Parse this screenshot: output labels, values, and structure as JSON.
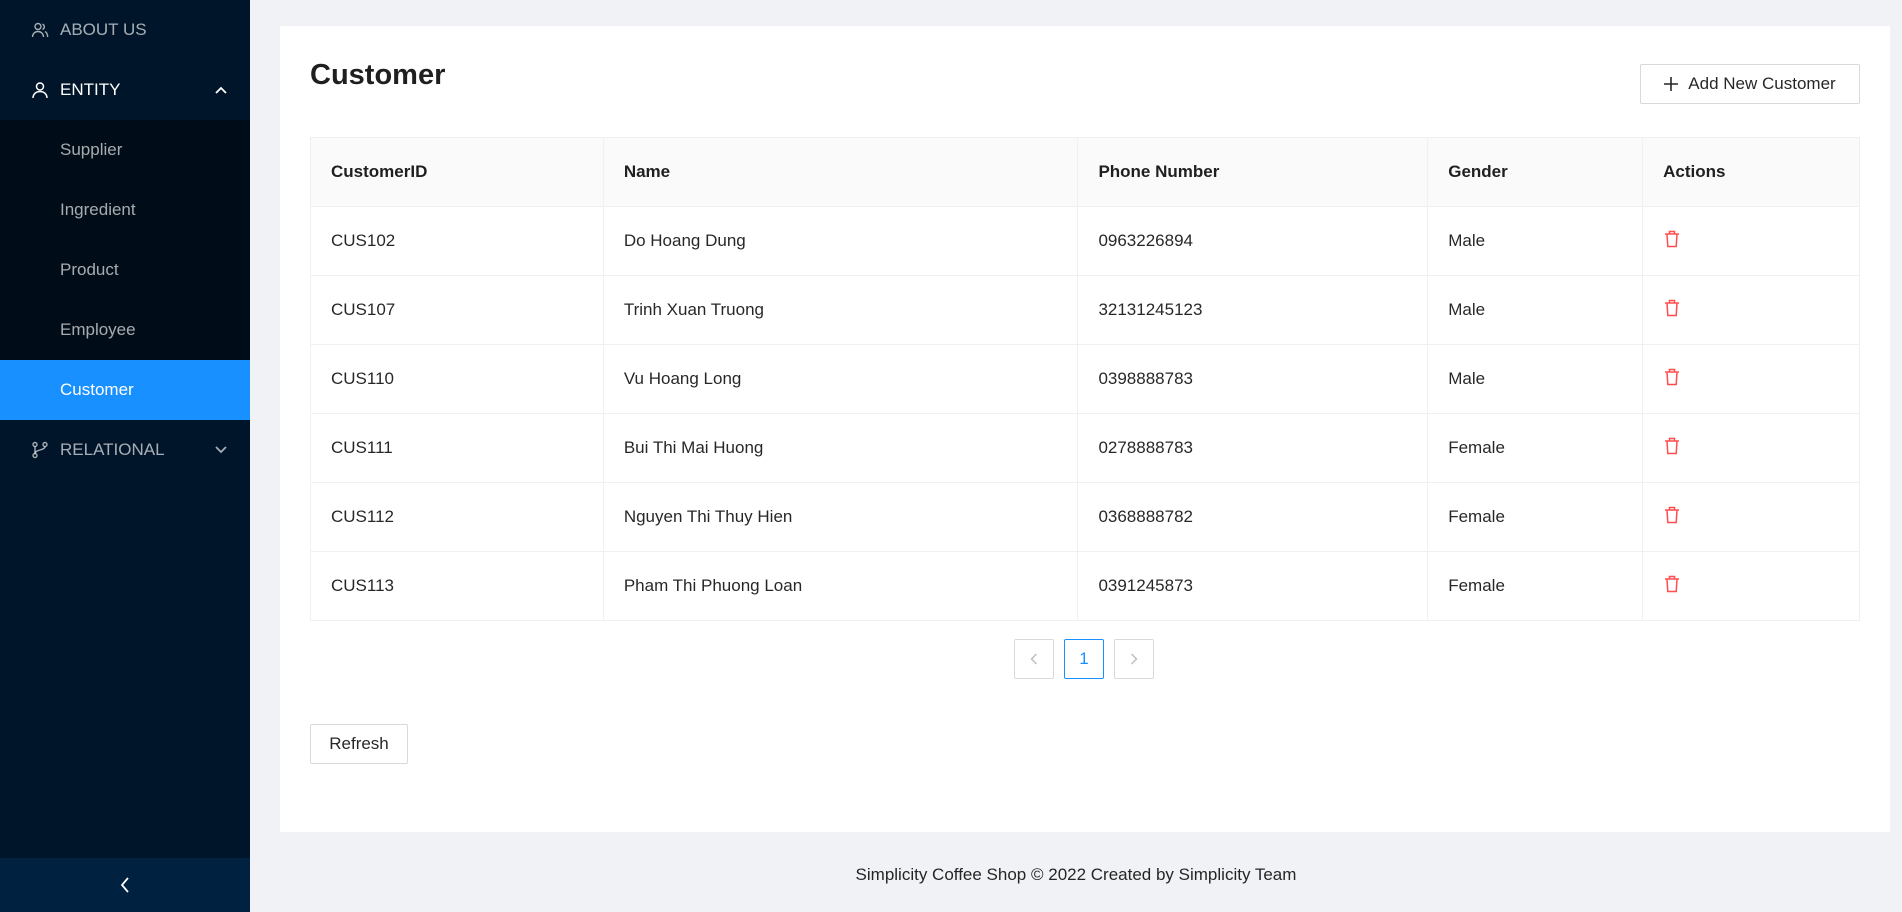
{
  "sidebar": {
    "items": [
      {
        "label": "ABOUT US",
        "icon": "team-icon"
      },
      {
        "label": "ENTITY",
        "icon": "user-icon",
        "expanded": true,
        "children": [
          "Supplier",
          "Ingredient",
          "Product",
          "Employee",
          "Customer"
        ],
        "selected": "Customer"
      },
      {
        "label": "RELATIONAL",
        "icon": "branches-icon",
        "expanded": false
      }
    ],
    "collapse_icon": "chevron-left-icon"
  },
  "main": {
    "title": "Customer",
    "add_button_label": "Add New Customer",
    "table": {
      "columns": [
        "CustomerID",
        "Name",
        "Phone Number",
        "Gender",
        "Actions"
      ],
      "rows": [
        [
          "CUS102",
          "Do Hoang Dung",
          "0963226894",
          "Male"
        ],
        [
          "CUS107",
          "Trinh Xuan Truong",
          "32131245123",
          "Male"
        ],
        [
          "CUS110",
          "Vu Hoang Long",
          "0398888783",
          "Male"
        ],
        [
          "CUS111",
          "Bui Thi Mai Huong",
          "0278888783",
          "Female"
        ],
        [
          "CUS112",
          "Nguyen Thi Thuy Hien",
          "0368888782",
          "Female"
        ],
        [
          "CUS113",
          "Pham Thi Phuong Loan",
          "0391245873",
          "Female"
        ]
      ],
      "action_icon": "delete-icon"
    },
    "pagination": {
      "current_page": "1"
    },
    "refresh_label": "Refresh"
  },
  "footer": {
    "text": "Simplicity Coffee Shop © 2022 Created by Simplicity Team"
  },
  "colors": {
    "sider_bg": "#001529",
    "submenu_bg": "#000c17",
    "selected": "#1890ff",
    "delete": "#ff4d4f"
  }
}
